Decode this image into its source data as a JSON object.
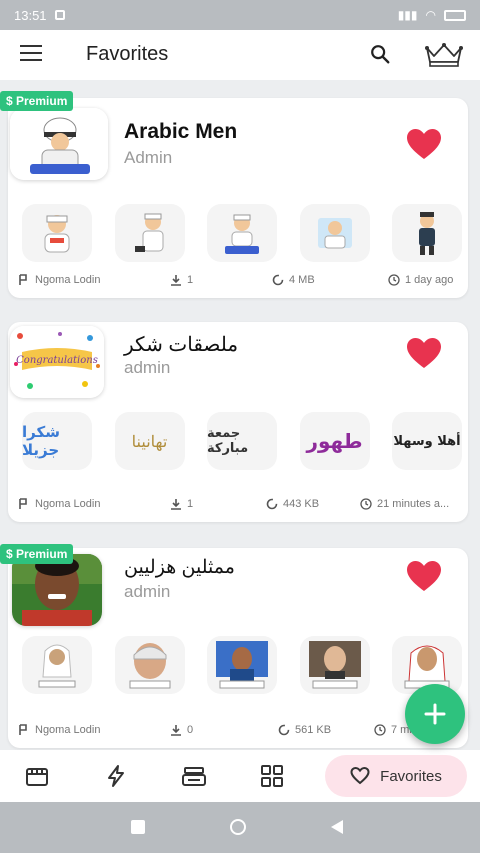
{
  "status": {
    "time": "13:51"
  },
  "appbar": {
    "title": "Favorites"
  },
  "packs": [
    {
      "name": "Arabic Men",
      "author": "Admin",
      "premium": "$ Premium",
      "meta": {
        "creator": "Ngoma Lodin",
        "downloads": "1",
        "size": "4 MB",
        "time": "1 day ago"
      }
    },
    {
      "name": "ملصقات شكر",
      "author": "admin",
      "thumb_text": "Congratulations",
      "sticker_texts": [
        "شكرا جزيلا",
        "تهانينا",
        "جمعة مباركة",
        "طهور",
        "أهلا وسهلا"
      ],
      "meta": {
        "creator": "Ngoma Lodin",
        "downloads": "1",
        "size": "443 KB",
        "time": "21 minutes a..."
      }
    },
    {
      "name": "ممثلين هزليين",
      "author": "admin",
      "premium": "$ Premium",
      "meta": {
        "creator": "Ngoma Lodin",
        "downloads": "0",
        "size": "561 KB",
        "time": "7 minutes ago"
      }
    }
  ],
  "bottomnav": {
    "favorites_label": "Favorites"
  },
  "colors": {
    "premium": "#2ec27e",
    "heart": "#e8334f",
    "fab": "#2ec27e",
    "favorites_pill": "#fde3ea"
  }
}
